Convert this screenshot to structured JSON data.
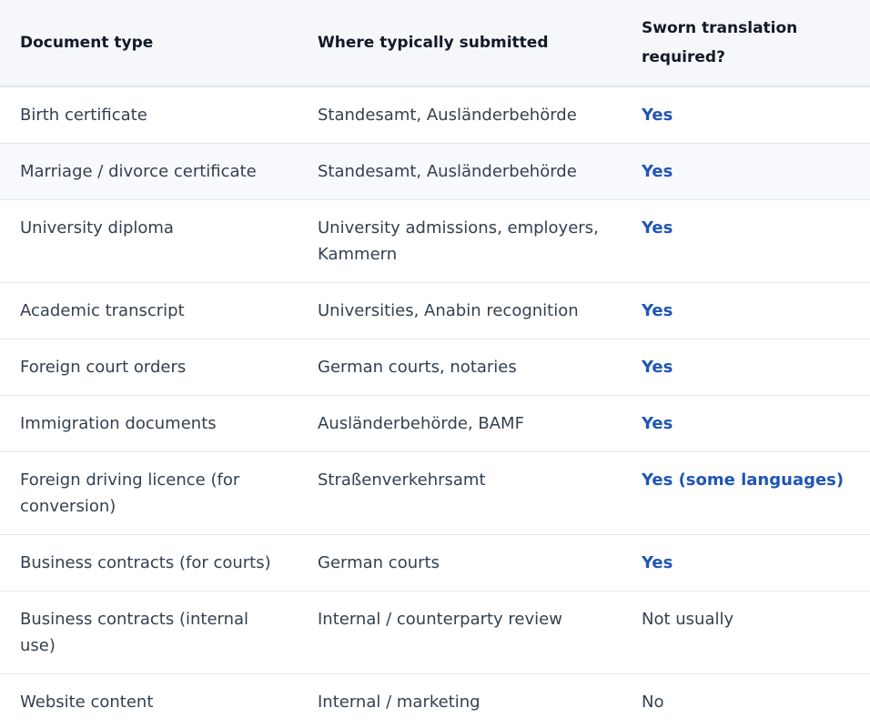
{
  "headers": {
    "document_type": "Document type",
    "where_submitted": "Where typically submitted",
    "sworn_translation": "Sworn translation required?"
  },
  "rows": [
    {
      "document": "Birth certificate",
      "where": "Standesamt, Ausländerbehörde",
      "sworn": "Yes"
    },
    {
      "document": "Marriage / divorce certificate",
      "where": "Standesamt, Ausländerbehörde",
      "sworn": "Yes"
    },
    {
      "document": "University diploma",
      "where": "University admissions, employers, Kammern",
      "sworn": "Yes"
    },
    {
      "document": "Academic transcript",
      "where": "Universities, Anabin recognition",
      "sworn": "Yes"
    },
    {
      "document": "Foreign court orders",
      "where": "German courts, notaries",
      "sworn": "Yes"
    },
    {
      "document": "Immigration documents",
      "where": "Ausländerbehörde, BAMF",
      "sworn": "Yes"
    },
    {
      "document": "Foreign driving licence (for conversion)",
      "where": "Straßenverkehrsamt",
      "sworn": "Yes (some languages)"
    },
    {
      "document": "Business contracts (for courts)",
      "where": "German courts",
      "sworn": "Yes"
    },
    {
      "document": "Business contracts (internal use)",
      "where": "Internal / counterparty review",
      "sworn": "Not usually"
    },
    {
      "document": "Website content",
      "where": "Internal / marketing",
      "sworn": "No"
    }
  ],
  "colors": {
    "yes_accent": "#1f56b5",
    "header_bg": "#f5f7fa",
    "alt_row_bg": "#f7f9fc",
    "text": "#34404f"
  }
}
